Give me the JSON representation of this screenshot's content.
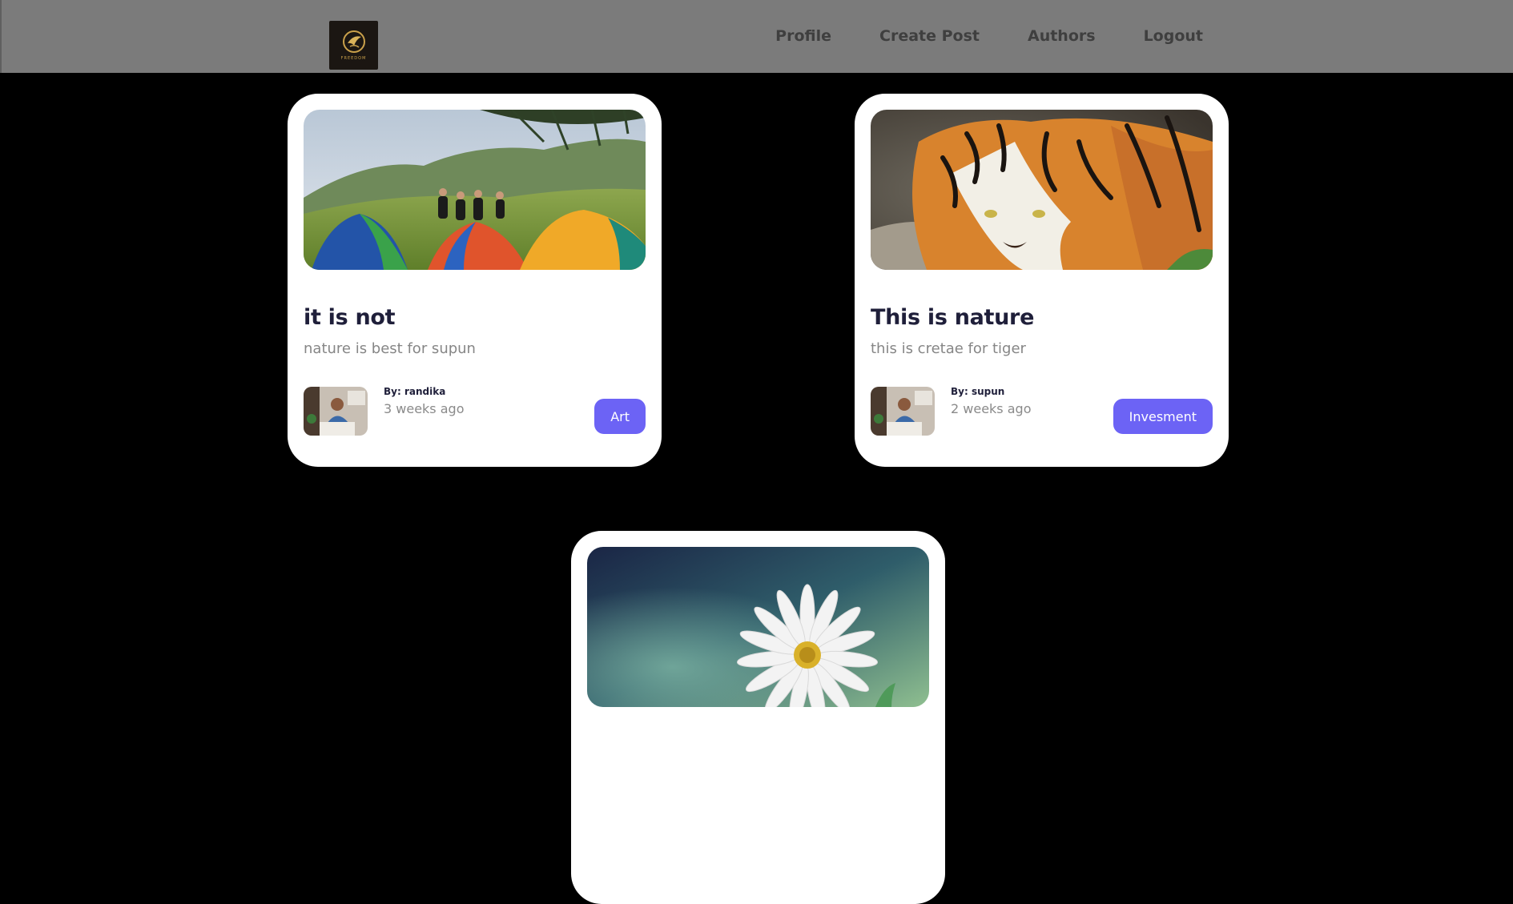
{
  "nav": {
    "logo_text": "FREEDOM",
    "links": [
      "Profile",
      "Create Post",
      "Authors",
      "Logout"
    ]
  },
  "posts": [
    {
      "title": "it is not",
      "description": "nature is best for supun",
      "author": "By: randika",
      "time": "3 weeks ago",
      "category": "Art"
    },
    {
      "title": "This is nature",
      "description": "this is cretae for tiger",
      "author": "By: supun",
      "time": "2 weeks ago",
      "category": "Invesment"
    },
    {
      "title": "",
      "description": "",
      "author": "",
      "time": "",
      "category": ""
    }
  ],
  "colors": {
    "navbar": "#7b7b7b",
    "background": "#000000",
    "accent": "#6c63f5",
    "title": "#1f1f3a"
  }
}
